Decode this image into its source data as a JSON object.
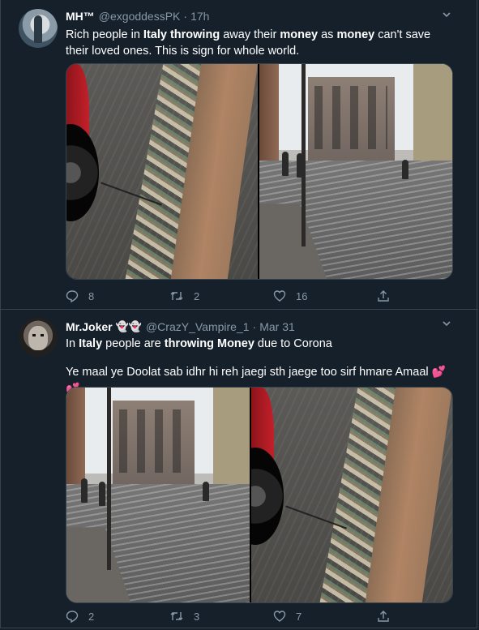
{
  "colors": {
    "background": "#15202b",
    "border": "#38444d",
    "muted": "#8899a6",
    "text": "#ffffff",
    "heart": "#e0245e"
  },
  "tweets": [
    {
      "name": "MH™",
      "handle": "@exgoddessPK",
      "time": "17h",
      "text_parts": [
        {
          "t": "Rich people in ",
          "b": false
        },
        {
          "t": "Italy",
          "b": true
        },
        {
          "t": " ",
          "b": false
        },
        {
          "t": "throwing",
          "b": true
        },
        {
          "t": " away their ",
          "b": false
        },
        {
          "t": "money",
          "b": true
        },
        {
          "t": " as ",
          "b": false
        },
        {
          "t": "money",
          "b": true
        },
        {
          "t": " can't save their loved ones. This is sign for whole world.",
          "b": false
        }
      ],
      "icons": {
        "avatar": "avatar-woman-icon",
        "more": "chevron-down-icon",
        "reply": "reply-icon",
        "retweet": "retweet-icon",
        "like": "heart-icon",
        "share": "share-icon"
      },
      "replies": "8",
      "retweets": "2",
      "likes": "16"
    },
    {
      "name": "Mr.Joker",
      "name_emoji": "👻👻",
      "handle": "@CrazY_Vampire_1",
      "time": "Mar 31",
      "text_parts": [
        {
          "t": "In ",
          "b": false
        },
        {
          "t": "Italy",
          "b": true
        },
        {
          "t": " people are ",
          "b": false
        },
        {
          "t": "throwing",
          "b": true
        },
        {
          "t": " ",
          "b": false
        },
        {
          "t": "Money",
          "b": true
        },
        {
          "t": " due to Corona",
          "b": false
        }
      ],
      "text2": "Ye maal ye Doolat sab idhr hi reh jaegi sth jaege too sirf hmare Amaal",
      "text2_emoji": "💕💕",
      "icons": {
        "avatar": "avatar-joker-icon",
        "more": "chevron-down-icon",
        "reply": "reply-icon",
        "retweet": "retweet-icon",
        "like": "heart-icon",
        "share": "share-icon"
      },
      "replies": "2",
      "retweets": "3",
      "likes": "7"
    }
  ]
}
